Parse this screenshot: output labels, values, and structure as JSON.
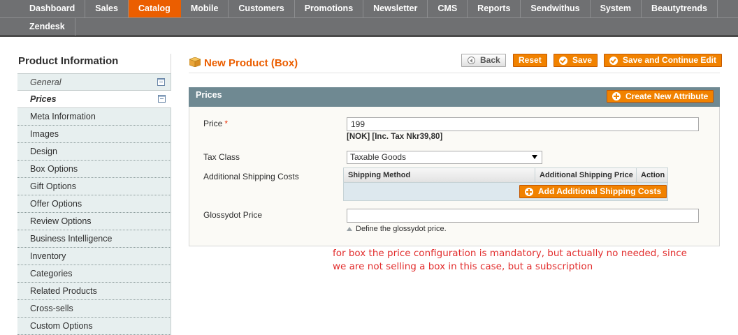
{
  "nav": {
    "row1": [
      "Dashboard",
      "Sales",
      "Catalog",
      "Mobile",
      "Customers",
      "Promotions",
      "Newsletter",
      "CMS",
      "Reports",
      "Sendwithus",
      "System",
      "Beautytrends"
    ],
    "row2": [
      "Zendesk"
    ],
    "active": "Catalog"
  },
  "sidebar": {
    "title": "Product Information",
    "tabs": [
      "General",
      "Prices"
    ],
    "items": [
      "Meta Information",
      "Images",
      "Design",
      "Box Options",
      "Gift Options",
      "Offer Options",
      "Review Options",
      "Business Intelligence",
      "Inventory",
      "Categories",
      "Related Products",
      "Cross-sells",
      "Custom Options"
    ]
  },
  "header": {
    "title": "New Product (Box)",
    "buttons": {
      "back": "Back",
      "reset": "Reset",
      "save": "Save",
      "save_continue": "Save and Continue Edit"
    }
  },
  "prices": {
    "title": "Prices",
    "create_attribute": "Create New Attribute",
    "price_label": "Price",
    "required_mark": "*",
    "price_value": "199",
    "price_note": "[NOK] [Inc. Tax Nkr39,80]",
    "tax_class_label": "Tax Class",
    "tax_class_value": "Taxable Goods",
    "shipping_label": "Additional Shipping Costs",
    "shipping_columns": [
      "Shipping Method",
      "Additional Shipping Price",
      "Action"
    ],
    "add_shipping": "Add Additional Shipping Costs",
    "glossydot_label": "Glossydot Price",
    "glossydot_value": "",
    "glossydot_note": "Define the glossydot price."
  },
  "annotation": {
    "line1": "for box the price configuration is mandatory, but actually no needed, since",
    "line2": "we are not selling a box in this case, but a subscription"
  },
  "colors": {
    "accent": "#eb5e00",
    "button": "#f18200",
    "nav_bg": "#6f7072",
    "fieldset_head": "#6f8992",
    "annotation": "#e22d2d"
  }
}
